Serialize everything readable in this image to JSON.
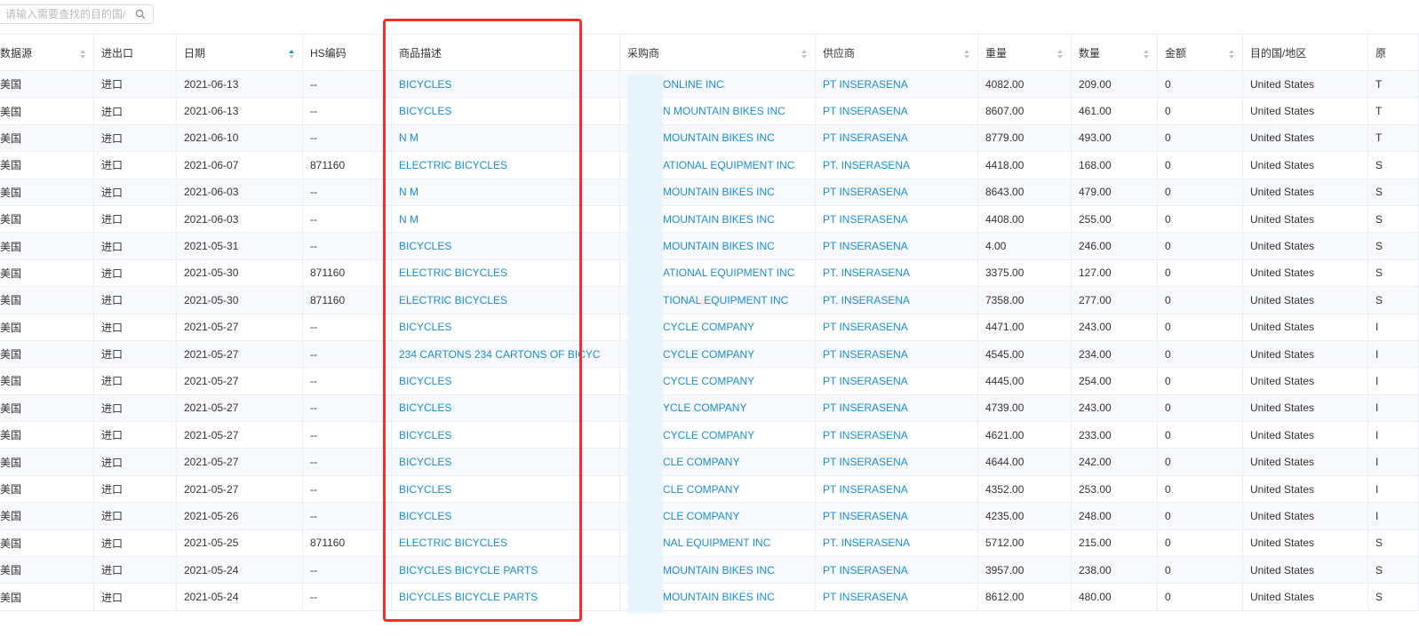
{
  "search": {
    "placeholder": "请输入需要查找的目的国/"
  },
  "colors": {
    "link": "#1a8fd8",
    "highlight_box": "#f0302d",
    "sort_active": "#1a8fd8"
  },
  "columns": [
    {
      "key": "source",
      "label": "数据源",
      "sortable": true
    },
    {
      "key": "io",
      "label": "进出口",
      "sortable": false
    },
    {
      "key": "date",
      "label": "日期",
      "sortable": true,
      "sort_active": true
    },
    {
      "key": "hs",
      "label": "HS编码",
      "sortable": false
    },
    {
      "key": "desc",
      "label": "商品描述",
      "sortable": false
    },
    {
      "key": "buyer",
      "label": "采购商",
      "sortable": true
    },
    {
      "key": "supplier",
      "label": "供应商",
      "sortable": true
    },
    {
      "key": "weight",
      "label": "重量",
      "sortable": true
    },
    {
      "key": "qty",
      "label": "数量",
      "sortable": true
    },
    {
      "key": "amount",
      "label": "金额",
      "sortable": true
    },
    {
      "key": "dest",
      "label": "目的国/地区",
      "sortable": false
    },
    {
      "key": "origin",
      "label": "原",
      "sortable": false
    }
  ],
  "rows": [
    {
      "source": "美国",
      "io": "进口",
      "date": "2021-06-13",
      "hs": "--",
      "desc": "BICYCLES",
      "buyer": "ONLINE INC",
      "supplier": "PT INSERASENA",
      "weight": "4082.00",
      "qty": "209.00",
      "amount": "0",
      "dest": "United States",
      "origin": "T"
    },
    {
      "source": "美国",
      "io": "进口",
      "date": "2021-06-13",
      "hs": "--",
      "desc": "BICYCLES",
      "buyer": "N MOUNTAIN BIKES INC",
      "supplier": "PT INSERASENA",
      "weight": "8607.00",
      "qty": "461.00",
      "amount": "0",
      "dest": "United States",
      "origin": "T"
    },
    {
      "source": "美国",
      "io": "进口",
      "date": "2021-06-10",
      "hs": "--",
      "desc": "N M",
      "buyer": "MOUNTAIN BIKES INC",
      "supplier": "PT INSERASENA",
      "weight": "8779.00",
      "qty": "493.00",
      "amount": "0",
      "dest": "United States",
      "origin": "T"
    },
    {
      "source": "美国",
      "io": "进口",
      "date": "2021-06-07",
      "hs": "871160",
      "desc": "ELECTRIC BICYCLES",
      "buyer": "ATIONAL EQUIPMENT INC",
      "supplier": "PT. INSERASENA",
      "weight": "4418.00",
      "qty": "168.00",
      "amount": "0",
      "dest": "United States",
      "origin": "S"
    },
    {
      "source": "美国",
      "io": "进口",
      "date": "2021-06-03",
      "hs": "--",
      "desc": "N M",
      "buyer": "MOUNTAIN BIKES INC",
      "supplier": "PT INSERASENA",
      "weight": "8643.00",
      "qty": "479.00",
      "amount": "0",
      "dest": "United States",
      "origin": "S"
    },
    {
      "source": "美国",
      "io": "进口",
      "date": "2021-06-03",
      "hs": "--",
      "desc": "N M",
      "buyer": "MOUNTAIN BIKES INC",
      "supplier": "PT INSERASENA",
      "weight": "4408.00",
      "qty": "255.00",
      "amount": "0",
      "dest": "United States",
      "origin": "S"
    },
    {
      "source": "美国",
      "io": "进口",
      "date": "2021-05-31",
      "hs": "--",
      "desc": "BICYCLES",
      "buyer": "MOUNTAIN BIKES INC",
      "supplier": "PT INSERASENA",
      "weight": "4.00",
      "qty": "246.00",
      "amount": "0",
      "dest": "United States",
      "origin": "S"
    },
    {
      "source": "美国",
      "io": "进口",
      "date": "2021-05-30",
      "hs": "871160",
      "desc": "ELECTRIC BICYCLES",
      "buyer": "ATIONAL EQUIPMENT INC",
      "supplier": "PT. INSERASENA",
      "weight": "3375.00",
      "qty": "127.00",
      "amount": "0",
      "dest": "United States",
      "origin": "S"
    },
    {
      "source": "美国",
      "io": "进口",
      "date": "2021-05-30",
      "hs": "871160",
      "desc": "ELECTRIC BICYCLES",
      "buyer": "TIONAL EQUIPMENT INC",
      "supplier": "PT. INSERASENA",
      "weight": "7358.00",
      "qty": "277.00",
      "amount": "0",
      "dest": "United States",
      "origin": "S"
    },
    {
      "source": "美国",
      "io": "进口",
      "date": "2021-05-27",
      "hs": "--",
      "desc": "BICYCLES",
      "buyer": "CYCLE COMPANY",
      "supplier": "PT INSERASENA",
      "weight": "4471.00",
      "qty": "243.00",
      "amount": "0",
      "dest": "United States",
      "origin": "I"
    },
    {
      "source": "美国",
      "io": "进口",
      "date": "2021-05-27",
      "hs": "--",
      "desc": "234 CARTONS 234 CARTONS OF BICYC",
      "buyer": "CYCLE COMPANY",
      "supplier": "PT INSERASENA",
      "weight": "4545.00",
      "qty": "234.00",
      "amount": "0",
      "dest": "United States",
      "origin": "I"
    },
    {
      "source": "美国",
      "io": "进口",
      "date": "2021-05-27",
      "hs": "--",
      "desc": "BICYCLES",
      "buyer": "CYCLE COMPANY",
      "supplier": "PT INSERASENA",
      "weight": "4445.00",
      "qty": "254.00",
      "amount": "0",
      "dest": "United States",
      "origin": "I"
    },
    {
      "source": "美国",
      "io": "进口",
      "date": "2021-05-27",
      "hs": "--",
      "desc": "BICYCLES",
      "buyer": "YCLE COMPANY",
      "supplier": "PT INSERASENA",
      "weight": "4739.00",
      "qty": "243.00",
      "amount": "0",
      "dest": "United States",
      "origin": "I"
    },
    {
      "source": "美国",
      "io": "进口",
      "date": "2021-05-27",
      "hs": "--",
      "desc": "BICYCLES",
      "buyer": "CYCLE COMPANY",
      "supplier": "PT INSERASENA",
      "weight": "4621.00",
      "qty": "233.00",
      "amount": "0",
      "dest": "United States",
      "origin": "I"
    },
    {
      "source": "美国",
      "io": "进口",
      "date": "2021-05-27",
      "hs": "--",
      "desc": "BICYCLES",
      "buyer": "CLE COMPANY",
      "supplier": "PT INSERASENA",
      "weight": "4644.00",
      "qty": "242.00",
      "amount": "0",
      "dest": "United States",
      "origin": "I"
    },
    {
      "source": "美国",
      "io": "进口",
      "date": "2021-05-27",
      "hs": "--",
      "desc": "BICYCLES",
      "buyer": "CLE COMPANY",
      "supplier": "PT INSERASENA",
      "weight": "4352.00",
      "qty": "253.00",
      "amount": "0",
      "dest": "United States",
      "origin": "I"
    },
    {
      "source": "美国",
      "io": "进口",
      "date": "2021-05-26",
      "hs": "--",
      "desc": "BICYCLES",
      "buyer": "CLE COMPANY",
      "supplier": "PT INSERASENA",
      "weight": "4235.00",
      "qty": "248.00",
      "amount": "0",
      "dest": "United States",
      "origin": "I"
    },
    {
      "source": "美国",
      "io": "进口",
      "date": "2021-05-25",
      "hs": "871160",
      "desc": "ELECTRIC BICYCLES",
      "buyer": "NAL EQUIPMENT INC",
      "supplier": "PT. INSERASENA",
      "weight": "5712.00",
      "qty": "215.00",
      "amount": "0",
      "dest": "United States",
      "origin": "S"
    },
    {
      "source": "美国",
      "io": "进口",
      "date": "2021-05-24",
      "hs": "--",
      "desc": "BICYCLES BICYCLE PARTS",
      "buyer": "MOUNTAIN BIKES INC",
      "supplier": "PT INSERASENA",
      "weight": "3957.00",
      "qty": "238.00",
      "amount": "0",
      "dest": "United States",
      "origin": "S"
    },
    {
      "source": "美国",
      "io": "进口",
      "date": "2021-05-24",
      "hs": "--",
      "desc": "BICYCLES BICYCLE PARTS",
      "buyer": "MOUNTAIN BIKES INC",
      "supplier": "PT INSERASENA",
      "weight": "8612.00",
      "qty": "480.00",
      "amount": "0",
      "dest": "United States",
      "origin": "S"
    }
  ]
}
